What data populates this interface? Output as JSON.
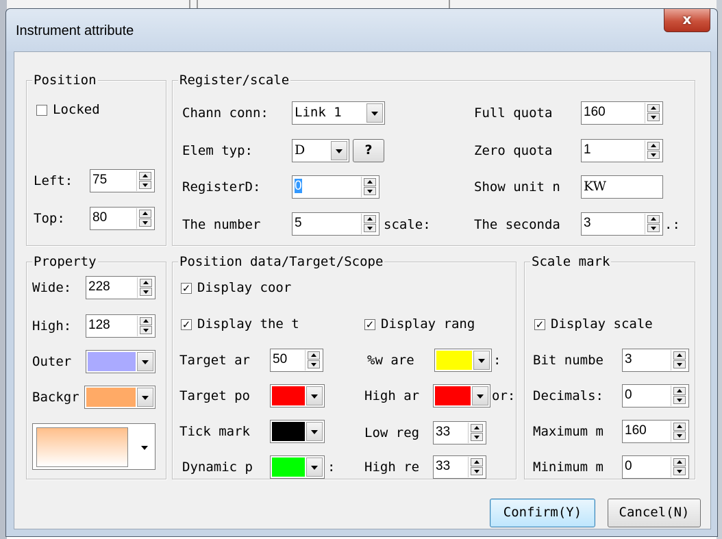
{
  "window": {
    "title": "Instrument attribute",
    "close_glyph": "x"
  },
  "position": {
    "legend": "Position",
    "locked_label": "Locked",
    "locked": false,
    "left_label": "Left:",
    "left_value": "75",
    "top_label": "Top:",
    "top_value": "80"
  },
  "register": {
    "legend": "Register/scale",
    "chann_label": "Chann conn:",
    "chann_value": "Link 1",
    "elem_label": "Elem typ:",
    "elem_value": "D",
    "help_label": "?",
    "register_label": "RegisterD:",
    "register_value": "0",
    "number_label": "The number",
    "number_value": "5",
    "number_suffix": "scale:",
    "full_label": "Full quota",
    "full_value": "160",
    "zero_label": "Zero quota",
    "zero_value": "1",
    "unit_label": "Show unit n",
    "unit_value": "KW",
    "second_label": "The seconda",
    "second_value": "3",
    "second_suffix": ".:"
  },
  "property": {
    "legend": "Property",
    "wide_label": "Wide:",
    "wide_value": "228",
    "high_label": "High:",
    "high_value": "128",
    "outer_label": "Outer",
    "outer_color": "#aaaaff",
    "backg_label": "Backgr",
    "backg_color": "#ffaa66"
  },
  "pdata": {
    "legend": "Position data/Target/Scope",
    "display_coor_label": "Display coor",
    "display_the_label": "Display the t",
    "display_range_label": "Display rang",
    "target_area_label": "Target ar",
    "target_area_value": "50",
    "target_po_label": "Target po",
    "target_po_color": "#ff0000",
    "tick_mark_label": "Tick mark",
    "tick_mark_color": "#000000",
    "dynamic_label": "Dynamic p",
    "dynamic_color": "#00ff00",
    "dynamic_suffix": ":",
    "low_area_label": "%w are",
    "low_area_color": "#ffff00",
    "low_area_suffix": ":",
    "high_area_label": "High ar",
    "high_area_color": "#ff0000",
    "high_area_suffix": "or:",
    "low_reg_label": "Low reg",
    "low_reg_value": "33",
    "high_reg_label": "High re",
    "high_reg_value": "33"
  },
  "scale": {
    "legend": "Scale mark",
    "display_scale_label": "Display scale",
    "bit_label": "Bit numbe",
    "bit_value": "3",
    "dec_label": "Decimals:",
    "dec_value": "0",
    "max_label": "Maximum m",
    "max_value": "160",
    "min_label": "Minimum m",
    "min_value": "0"
  },
  "buttons": {
    "confirm": "Confirm(Y)",
    "cancel": "Cancel(N)"
  }
}
